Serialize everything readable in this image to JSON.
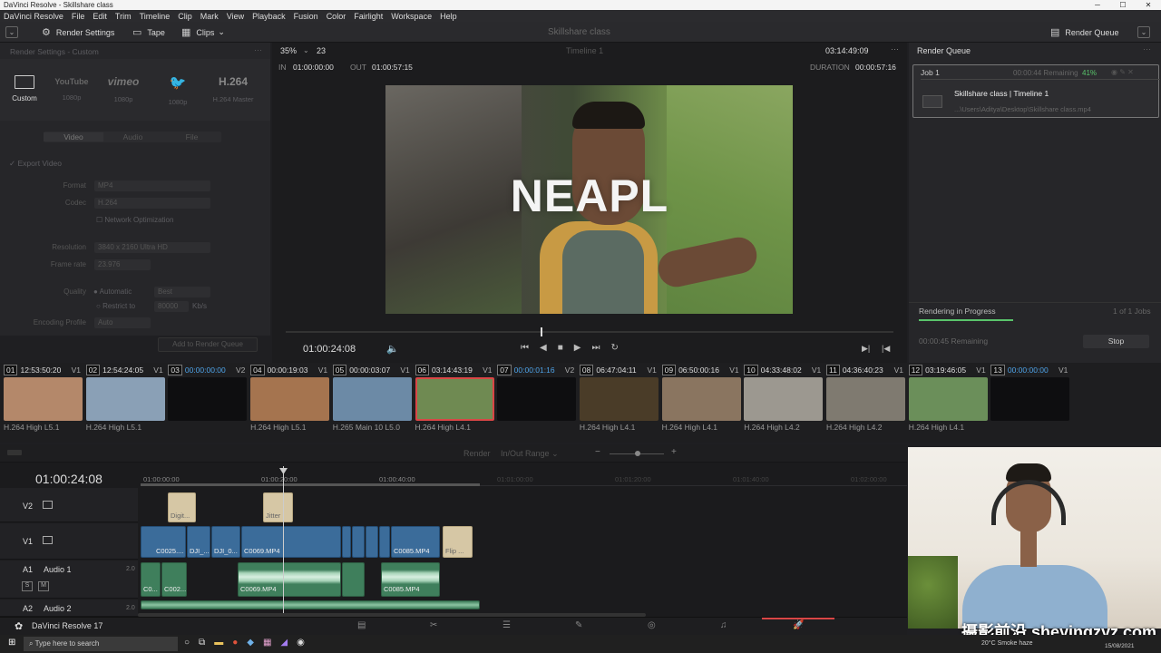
{
  "window": {
    "title": "DaVinci Resolve - Skillshare class",
    "controls": [
      "─",
      "☐",
      "✕"
    ]
  },
  "menu": [
    "DaVinci Resolve",
    "File",
    "Edit",
    "Trim",
    "Timeline",
    "Clip",
    "Mark",
    "View",
    "Playback",
    "Fusion",
    "Color",
    "Fairlight",
    "Workspace",
    "Help"
  ],
  "toolbar": {
    "render_settings": "Render Settings",
    "tape": "Tape",
    "clips": "Clips",
    "project": "Skillshare class",
    "render_queue": "Render Queue"
  },
  "render_settings": {
    "title": "Render Settings - Custom",
    "presets": [
      {
        "label": "Custom",
        "sub": ""
      },
      {
        "label": "YouTube",
        "sub": "1080p"
      },
      {
        "label": "vimeo",
        "sub": "1080p"
      },
      {
        "label": "Twitter",
        "sub": "1080p"
      },
      {
        "label": "H.264",
        "sub": "H.264 Master"
      }
    ],
    "tabs": [
      "Video",
      "Audio",
      "File"
    ],
    "export_video": "Export Video",
    "fields": [
      {
        "label": "Format",
        "value": "MP4"
      },
      {
        "label": "Codec",
        "value": "H.264"
      },
      {
        "label": "",
        "value": "Network Optimization"
      },
      {
        "label": "Resolution",
        "value": "3840 x 2160 Ultra HD"
      },
      {
        "label": "Frame rate",
        "value": "23.976"
      },
      {
        "label": "Quality",
        "value": "Automatic"
      },
      {
        "label": "",
        "value": "Restrict to"
      },
      {
        "label": "Encoding Profile",
        "value": "Auto"
      }
    ],
    "quality_best": "Best",
    "restrict_value": "80000",
    "restrict_unit": "Kb/s",
    "add_to_queue": "Add to Render Queue"
  },
  "viewer": {
    "zoom": "35%",
    "frame": "23",
    "timeline_name": "Timeline 1",
    "timecode_top": "03:14:49:09",
    "in_label": "IN",
    "in_tc": "01:00:00:00",
    "out_label": "OUT",
    "out_tc": "01:00:57:15",
    "duration_label": "DURATION",
    "duration": "00:00:57:16",
    "overlay_text": "NEAPL",
    "current_tc": "01:00:24:08"
  },
  "render_queue": {
    "job_name": "Job 1",
    "remaining": "00:00:44 Remaining",
    "percent": "41%",
    "job_title": "Skillshare class | Timeline 1",
    "job_path": "...\\Users\\Aditya\\Desktop\\Skillshare class.mp4",
    "status": "Rendering in Progress",
    "jobs_count": "1 of 1 Jobs",
    "remaining_bottom": "00:00:45 Remaining",
    "stop": "Stop"
  },
  "clips": [
    {
      "num": "01",
      "tc": "12:53:50:20",
      "track": "V1",
      "footer": "H.264 High L5.1",
      "blue": false,
      "color": "#b4886a"
    },
    {
      "num": "02",
      "tc": "12:54:24:05",
      "track": "V1",
      "footer": "H.264 High L5.1",
      "blue": false,
      "color": "#8aa0b6"
    },
    {
      "num": "03",
      "tc": "00:00:00:00",
      "track": "V2",
      "footer": "",
      "blue": true,
      "color": "#0e0e10"
    },
    {
      "num": "04",
      "tc": "00:00:19:03",
      "track": "V1",
      "footer": "H.264 High L5.1",
      "blue": false,
      "color": "#a5744f"
    },
    {
      "num": "05",
      "tc": "00:00:03:07",
      "track": "V1",
      "footer": "H.265 Main 10 L5.0",
      "blue": false,
      "color": "#6c8aa6"
    },
    {
      "num": "06",
      "tc": "03:14:43:19",
      "track": "V1",
      "footer": "H.264 High L4.1",
      "blue": false,
      "color": "#6f8a52"
    },
    {
      "num": "07",
      "tc": "00:00:01:16",
      "track": "V2",
      "footer": "",
      "blue": true,
      "color": "#0e0e10"
    },
    {
      "num": "08",
      "tc": "06:47:04:11",
      "track": "V1",
      "footer": "H.264 High L4.1",
      "blue": false,
      "color": "#4a3c28"
    },
    {
      "num": "09",
      "tc": "06:50:00:16",
      "track": "V1",
      "footer": "H.264 High L4.1",
      "blue": false,
      "color": "#8a7560"
    },
    {
      "num": "10",
      "tc": "04:33:48:02",
      "track": "V1",
      "footer": "H.264 High L4.2",
      "blue": false,
      "color": "#9c9890"
    },
    {
      "num": "11",
      "tc": "04:36:40:23",
      "track": "V1",
      "footer": "H.264 High L4.2",
      "blue": false,
      "color": "#7f7a70"
    },
    {
      "num": "12",
      "tc": "03:19:46:05",
      "track": "V1",
      "footer": "H.264 High L4.1",
      "blue": false,
      "color": "#6b8f5a"
    },
    {
      "num": "13",
      "tc": "00:00:00:00",
      "track": "V1",
      "footer": "",
      "blue": true,
      "color": "#0e0e10"
    }
  ],
  "timeline": {
    "timecode": "01:00:24:08",
    "render_label": "Render",
    "render_range": "In/Out Range",
    "ruler": [
      "01:00:00:00",
      "01:00:20:00",
      "01:00:40:00",
      "01:01:00:00",
      "01:01:20:00",
      "01:01:40:00",
      "01:02:00:00"
    ],
    "tracks": {
      "v2": "V2",
      "v1": "V1",
      "a1": "A1",
      "a1_name": "Audio 1",
      "a1_level": "2.0",
      "a2": "A2",
      "a2_name": "Audio 2",
      "a2_level": "2.0"
    },
    "v2_clips": [
      "Digit...",
      "Jitter"
    ],
    "v1_clips": [
      "C0025....",
      "DJI_...",
      "DJI_0...",
      "C0069.MP4",
      "C0085.MP4",
      "Flip ..."
    ],
    "a1_clips": [
      "C0...",
      "C002...",
      "C0069.MP4",
      "C0085.MP4"
    ],
    "s_label": "S",
    "m_label": "M"
  },
  "pages": {
    "app": "DaVinci Resolve 17"
  },
  "taskbar": {
    "search": "Type here to search",
    "weather": "20°C Smoke haze",
    "date": "15/08/2021"
  },
  "watermark": "摄影前沿 sheyingzyz.com",
  "colors": {
    "accent_green": "#59c46b",
    "accent_red": "#d94646",
    "timeline_video": "#3b6c9a",
    "timeline_audio": "#3f7f5c"
  }
}
